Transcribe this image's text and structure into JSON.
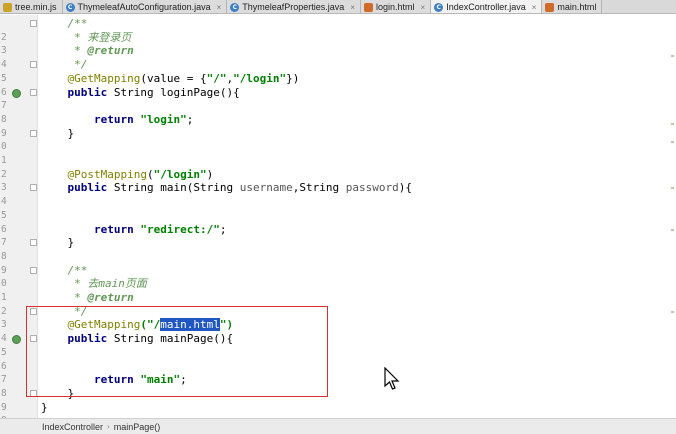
{
  "tabs": [
    {
      "label": "tree.min.js",
      "icon": "js-file-icon",
      "active": false
    },
    {
      "label": "ThymeleafAutoConfiguration.java",
      "icon": "java-class-icon",
      "active": false
    },
    {
      "label": "ThymeleafProperties.java",
      "icon": "java-class-icon",
      "active": false
    },
    {
      "label": "login.html",
      "icon": "html-file-icon",
      "active": false
    },
    {
      "label": "IndexController.java",
      "icon": "java-class-icon",
      "active": true
    },
    {
      "label": "main.html",
      "icon": "html-file-icon",
      "active": false
    }
  ],
  "code": {
    "lines": [
      {
        "num": "2"
      },
      {
        "num": "3"
      },
      {
        "num": "4"
      },
      {
        "num": "5"
      },
      {
        "num": "6"
      },
      {
        "num": "7"
      },
      {
        "num": "8"
      },
      {
        "num": "9"
      },
      {
        "num": "0"
      },
      {
        "num": "1"
      },
      {
        "num": "2"
      },
      {
        "num": "3"
      },
      {
        "num": "4"
      },
      {
        "num": "5"
      },
      {
        "num": "6"
      },
      {
        "num": "7"
      },
      {
        "num": "8"
      },
      {
        "num": "9"
      },
      {
        "num": "0"
      },
      {
        "num": "1"
      },
      {
        "num": "2"
      },
      {
        "num": "3"
      },
      {
        "num": "4"
      },
      {
        "num": "5"
      },
      {
        "num": "6"
      },
      {
        "num": "7"
      },
      {
        "num": "8"
      },
      {
        "num": "9"
      },
      {
        "num": "0"
      }
    ],
    "t": {
      "doc_open": "/**",
      "doc_star": " * ",
      "doc_close": " */",
      "comment_login": "来登录页",
      "comment_main": "去main页面",
      "tag_return": "@return",
      "ann_get": "@GetMapping",
      "ann_post": "@PostMapping",
      "kw_public": "public",
      "kw_return": "return",
      "type_string": "String",
      "get_login_args_pre": "(value = {",
      "str_slash": "\"/\"",
      "comma": ",",
      "str_login_path": "\"/login\"",
      "get_login_args_post": "})",
      "login_method": " loginPage(){",
      "str_login": "\"login\"",
      "semicolon": ";",
      "close_brace": "}",
      "post_open": "(",
      "post_close": ")",
      "main_method_pre": " main(",
      "param_username": "username",
      "param_password": "password",
      "main_method_post": "){",
      "space": " ",
      "str_redirect": "\"redirect:/\"",
      "get_main_open": "(\"/",
      "selected_text": "main.html",
      "get_main_close": "\")",
      "main_page_method": " mainPage(){",
      "str_main": "\"main\""
    }
  },
  "breadcrumb": {
    "items": [
      "IndexController",
      "mainPage()"
    ],
    "separator": "›"
  }
}
